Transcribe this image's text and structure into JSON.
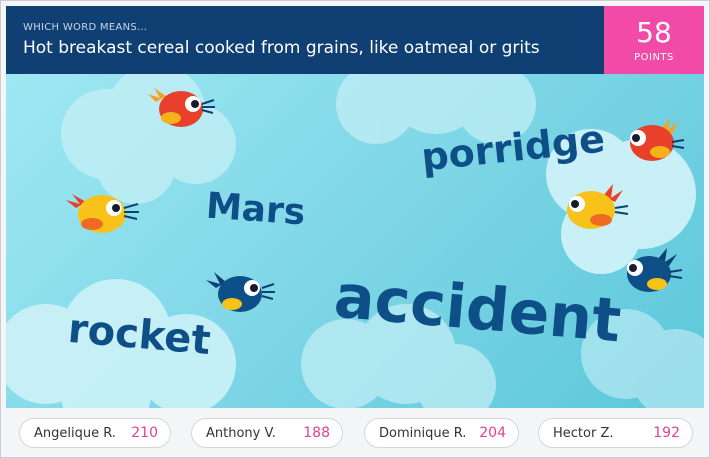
{
  "header": {
    "prompt_label": "WHICH WORD MEANS…",
    "question": "Hot breakast cereal cooked from grains, like oatmeal or grits"
  },
  "score": {
    "value": "58",
    "label": "POINTS"
  },
  "words": [
    {
      "text": "porridge"
    },
    {
      "text": "Mars"
    },
    {
      "text": "accident"
    },
    {
      "text": "rocket"
    }
  ],
  "players": [
    {
      "name": "Angelique R.",
      "score": "210"
    },
    {
      "name": "Anthony V.",
      "score": "188"
    },
    {
      "name": "Dominique R.",
      "score": "204"
    },
    {
      "name": "Hector Z.",
      "score": "192"
    }
  ],
  "colors": {
    "header_bg": "#0f3f73",
    "points_bg": "#f24ba7",
    "word_color": "#0d4f86",
    "score_color": "#e0409a",
    "sky": "#7ed6e6"
  }
}
